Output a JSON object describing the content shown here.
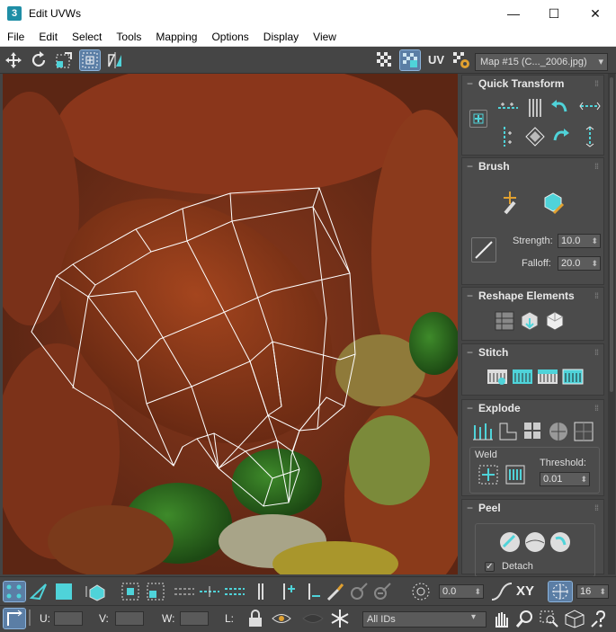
{
  "window": {
    "title": "Edit UVWs",
    "app_icon_text": "3",
    "minimize": "—",
    "maximize": "☐",
    "close": "✕"
  },
  "menu": [
    "File",
    "Edit",
    "Select",
    "Tools",
    "Mapping",
    "Options",
    "Display",
    "View"
  ],
  "toolbar": {
    "uv_label": "UV",
    "map_dropdown": "Map #15 (C..._2006.jpg)"
  },
  "panel": {
    "quick_transform": {
      "title": "Quick Transform"
    },
    "brush": {
      "title": "Brush",
      "strength_label": "Strength:",
      "strength_value": "10.0",
      "falloff_label": "Falloff:",
      "falloff_value": "20.0"
    },
    "reshape": {
      "title": "Reshape Elements"
    },
    "stitch": {
      "title": "Stitch"
    },
    "explode": {
      "title": "Explode",
      "weld_label": "Weld",
      "threshold_label": "Threshold:",
      "threshold_value": "0.01"
    },
    "peel": {
      "title": "Peel",
      "detach_label": "Detach",
      "detach_checked": true
    }
  },
  "bottom_bar1": {
    "rotate_value": "0.0",
    "xy_label": "XY",
    "grid_value": "16"
  },
  "bottom_bar2": {
    "u_label": "U:",
    "v_label": "V:",
    "w_label": "W:",
    "l_label": "L:",
    "ids_dropdown": "All IDs"
  },
  "colors": {
    "accent": "#4fd3d9",
    "panel": "#444444",
    "active_blue": "#5b7ea5"
  }
}
